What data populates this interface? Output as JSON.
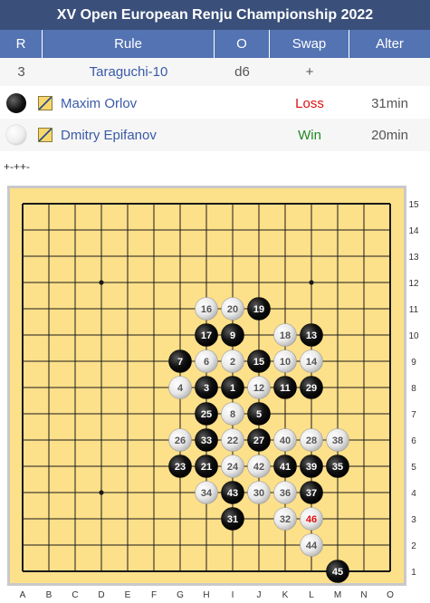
{
  "title": "XV Open European Renju Championship 2022",
  "headers": {
    "r": "R",
    "rule": "Rule",
    "o": "O",
    "swap": "Swap",
    "alter": "Alter"
  },
  "game": {
    "round": "3",
    "rule": "Taraguchi-10",
    "opening": "d6",
    "swap": "+",
    "alter": ""
  },
  "players": [
    {
      "stone": "black",
      "name": "Maxim Orlov",
      "result": "Loss",
      "time": "31min"
    },
    {
      "stone": "white",
      "name": "Dmitry Epifanov",
      "result": "Win",
      "time": "20min"
    }
  ],
  "moves_string": "+-++-",
  "board": {
    "columns": [
      "A",
      "B",
      "C",
      "D",
      "E",
      "F",
      "G",
      "H",
      "I",
      "J",
      "K",
      "L",
      "M",
      "N",
      "O"
    ],
    "rows": [
      "15",
      "14",
      "13",
      "12",
      "11",
      "10",
      "9",
      "8",
      "7",
      "6",
      "5",
      "4",
      "3",
      "2",
      "1"
    ],
    "stones": [
      {
        "n": "1",
        "col": "I",
        "row": 8,
        "color": "black"
      },
      {
        "n": "2",
        "col": "I",
        "row": 9,
        "color": "white"
      },
      {
        "n": "3",
        "col": "H",
        "row": 8,
        "color": "black"
      },
      {
        "n": "4",
        "col": "G",
        "row": 8,
        "color": "white"
      },
      {
        "n": "5",
        "col": "J",
        "row": 7,
        "color": "black"
      },
      {
        "n": "6",
        "col": "H",
        "row": 9,
        "color": "white"
      },
      {
        "n": "7",
        "col": "G",
        "row": 9,
        "color": "black"
      },
      {
        "n": "8",
        "col": "I",
        "row": 7,
        "color": "white"
      },
      {
        "n": "9",
        "col": "I",
        "row": 10,
        "color": "black"
      },
      {
        "n": "10",
        "col": "K",
        "row": 9,
        "color": "white"
      },
      {
        "n": "11",
        "col": "K",
        "row": 8,
        "color": "black"
      },
      {
        "n": "12",
        "col": "J",
        "row": 8,
        "color": "white"
      },
      {
        "n": "13",
        "col": "L",
        "row": 10,
        "color": "black"
      },
      {
        "n": "14",
        "col": "L",
        "row": 9,
        "color": "white"
      },
      {
        "n": "15",
        "col": "J",
        "row": 9,
        "color": "black"
      },
      {
        "n": "16",
        "col": "H",
        "row": 11,
        "color": "white"
      },
      {
        "n": "17",
        "col": "H",
        "row": 10,
        "color": "black"
      },
      {
        "n": "18",
        "col": "K",
        "row": 10,
        "color": "white"
      },
      {
        "n": "19",
        "col": "J",
        "row": 11,
        "color": "black"
      },
      {
        "n": "20",
        "col": "I",
        "row": 11,
        "color": "white"
      },
      {
        "n": "21",
        "col": "H",
        "row": 5,
        "color": "black"
      },
      {
        "n": "22",
        "col": "I",
        "row": 6,
        "color": "white"
      },
      {
        "n": "23",
        "col": "G",
        "row": 5,
        "color": "black"
      },
      {
        "n": "24",
        "col": "I",
        "row": 5,
        "color": "white"
      },
      {
        "n": "25",
        "col": "H",
        "row": 7,
        "color": "black"
      },
      {
        "n": "26",
        "col": "G",
        "row": 6,
        "color": "white"
      },
      {
        "n": "27",
        "col": "J",
        "row": 6,
        "color": "black"
      },
      {
        "n": "28",
        "col": "L",
        "row": 6,
        "color": "white"
      },
      {
        "n": "29",
        "col": "L",
        "row": 8,
        "color": "black"
      },
      {
        "n": "30",
        "col": "J",
        "row": 4,
        "color": "white"
      },
      {
        "n": "31",
        "col": "I",
        "row": 3,
        "color": "black"
      },
      {
        "n": "32",
        "col": "K",
        "row": 3,
        "color": "white"
      },
      {
        "n": "33",
        "col": "H",
        "row": 6,
        "color": "black"
      },
      {
        "n": "34",
        "col": "H",
        "row": 4,
        "color": "white"
      },
      {
        "n": "35",
        "col": "M",
        "row": 5,
        "color": "black"
      },
      {
        "n": "36",
        "col": "K",
        "row": 4,
        "color": "white"
      },
      {
        "n": "37",
        "col": "L",
        "row": 4,
        "color": "black"
      },
      {
        "n": "38",
        "col": "M",
        "row": 6,
        "color": "white"
      },
      {
        "n": "39",
        "col": "L",
        "row": 5,
        "color": "black"
      },
      {
        "n": "40",
        "col": "K",
        "row": 6,
        "color": "white"
      },
      {
        "n": "41",
        "col": "K",
        "row": 5,
        "color": "black"
      },
      {
        "n": "42",
        "col": "J",
        "row": 5,
        "color": "white"
      },
      {
        "n": "43",
        "col": "I",
        "row": 4,
        "color": "black"
      },
      {
        "n": "44",
        "col": "L",
        "row": 2,
        "color": "white"
      },
      {
        "n": "45",
        "col": "M",
        "row": 1,
        "color": "black"
      },
      {
        "n": "46",
        "col": "L",
        "row": 3,
        "color": "white",
        "last": true
      }
    ],
    "colors": {
      "board": "#fde08a",
      "grid": "#1a1a1a",
      "frame": "#c9c9c9",
      "last_move_text": "#e01010"
    }
  }
}
